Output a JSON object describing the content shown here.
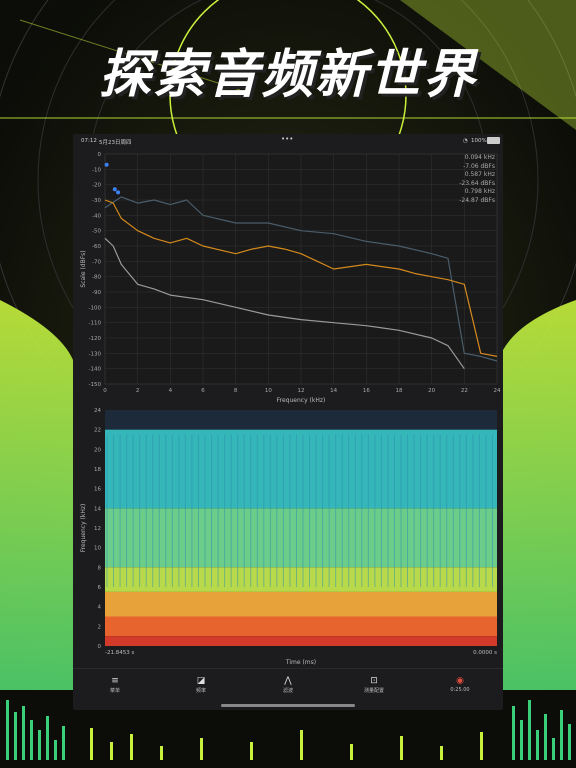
{
  "promo": {
    "headline": "探索音频新世界"
  },
  "status_bar": {
    "time": "07:12",
    "date": "5月23日周四",
    "dots": "•••",
    "battery": "100%"
  },
  "readout": {
    "lines": [
      "0.094 kHz",
      "-7.06 dBFs",
      "0.587 kHz",
      "-23.64 dBFs",
      "0.798 kHz",
      "-24.87 dBFs"
    ]
  },
  "chart_data": [
    {
      "type": "line",
      "xlabel": "Frequency (kHz)",
      "ylabel": "Scale (dBFs)",
      "xlim": [
        0,
        24
      ],
      "ylim": [
        -150,
        0
      ],
      "x_ticks": [
        "0",
        "2",
        "4",
        "6",
        "8",
        "10",
        "12",
        "14",
        "16",
        "18",
        "20",
        "22",
        "24"
      ],
      "y_ticks": [
        "0",
        "-10",
        "-20",
        "-30",
        "-40",
        "-50",
        "-60",
        "-70",
        "-80",
        "-90",
        "-100",
        "-110",
        "-120",
        "-130",
        "-140",
        "-150"
      ],
      "series": [
        {
          "color": "#4a5d6a",
          "x": [
            0,
            1,
            2,
            3,
            4,
            5,
            6,
            8,
            10,
            12,
            14,
            16,
            18,
            20,
            21,
            22,
            23,
            24
          ],
          "values": [
            -35,
            -28,
            -32,
            -30,
            -33,
            -30,
            -40,
            -45,
            -45,
            -50,
            -52,
            -57,
            -60,
            -65,
            -68,
            -130,
            -132,
            -135
          ]
        },
        {
          "color": "#d4891c",
          "x": [
            0,
            0.5,
            1,
            2,
            3,
            4,
            5,
            6,
            8,
            9,
            10,
            11,
            12,
            13,
            14,
            16,
            18,
            19,
            20,
            21,
            22,
            23,
            24
          ],
          "values": [
            -30,
            -32,
            -42,
            -50,
            -55,
            -58,
            -55,
            -60,
            -65,
            -62,
            -60,
            -62,
            -65,
            -70,
            -75,
            -72,
            -75,
            -78,
            -80,
            -82,
            -85,
            -130,
            -132
          ]
        },
        {
          "color": "#9a9a9a",
          "x": [
            0,
            0.5,
            1,
            2,
            3,
            4,
            6,
            8,
            10,
            12,
            14,
            16,
            18,
            20,
            21,
            22
          ],
          "values": [
            -55,
            -60,
            -72,
            -85,
            -88,
            -92,
            -95,
            -100,
            -105,
            -108,
            -110,
            -112,
            -115,
            -120,
            -125,
            -140
          ]
        }
      ],
      "markers": {
        "color": "#3b82f6",
        "points": [
          [
            0.1,
            -7
          ],
          [
            0.6,
            -23
          ],
          [
            0.8,
            -25
          ]
        ]
      }
    },
    {
      "type": "heatmap",
      "xlabel": "Time (ms)",
      "ylabel": "Frequency (kHz)",
      "ylim": [
        0,
        24
      ],
      "y_ticks": [
        "0",
        "2",
        "4",
        "6",
        "8",
        "10",
        "12",
        "14",
        "16",
        "18",
        "20",
        "22",
        "24"
      ],
      "x_start_label": "-21.8453 s",
      "x_end_label": "0.0000 s"
    }
  ],
  "toolbar": {
    "items": [
      {
        "label": "菜单",
        "icon": "≡"
      },
      {
        "label": "频率",
        "icon": "◪"
      },
      {
        "label": "滤波",
        "icon": "⋀"
      },
      {
        "label": "测量配置",
        "icon": "⊡"
      },
      {
        "label": "0:25.00",
        "icon": "◉"
      }
    ]
  },
  "colors": {
    "accent_green": "#c8f03c",
    "orange": "#d4891c",
    "record_red": "#e24c3f"
  }
}
